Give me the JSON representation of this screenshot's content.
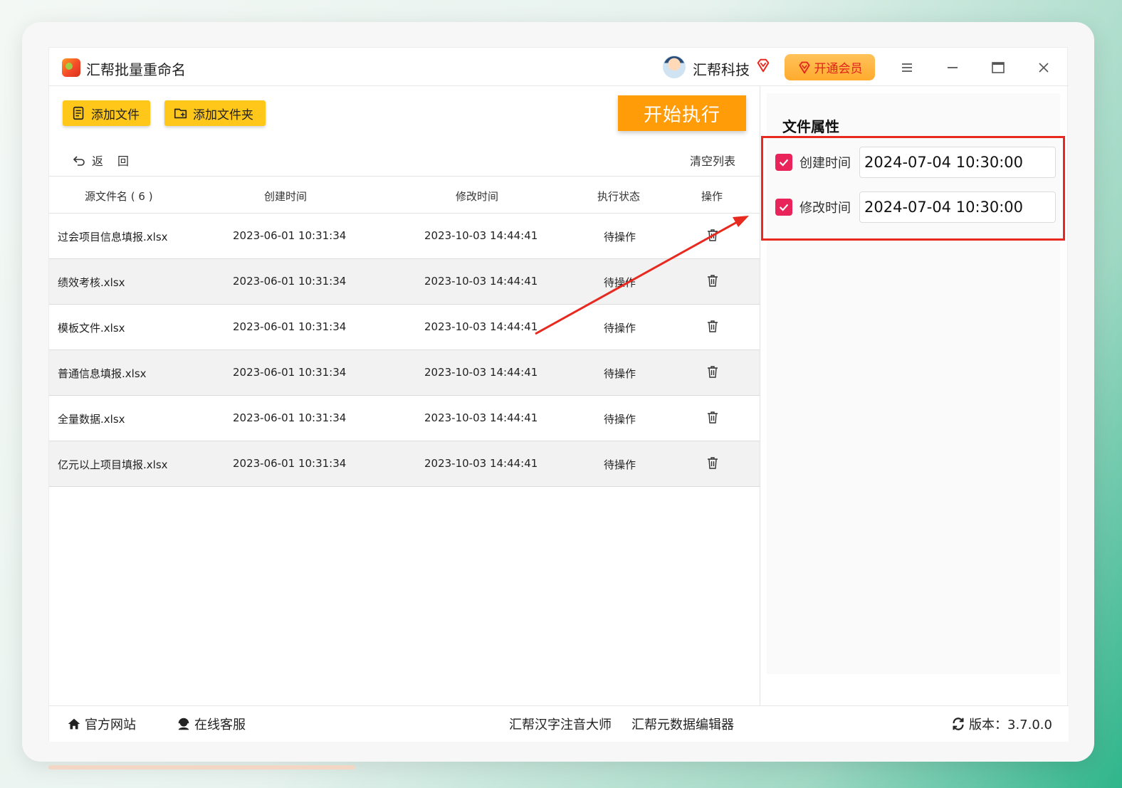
{
  "app": {
    "title": "汇帮批量重命名",
    "user_name": "汇帮科技",
    "vip_label": "开通会员"
  },
  "toolbar": {
    "add_file_label": "添加文件",
    "add_folder_label": "添加文件夹",
    "start_label": "开始执行",
    "back_label": "返回",
    "clear_label": "清空列表"
  },
  "table": {
    "headers": {
      "name": "源文件名 ( 6 )",
      "created": "创建时间",
      "modified": "修改时间",
      "status": "执行状态",
      "op": "操作"
    },
    "rows": [
      {
        "name": "过会项目信息填报.xlsx",
        "created": "2023-06-01 10:31:34",
        "modified": "2023-10-03 14:44:41",
        "status": "待操作"
      },
      {
        "name": "绩效考核.xlsx",
        "created": "2023-06-01 10:31:34",
        "modified": "2023-10-03 14:44:41",
        "status": "待操作"
      },
      {
        "name": "模板文件.xlsx",
        "created": "2023-06-01 10:31:34",
        "modified": "2023-10-03 14:44:41",
        "status": "待操作"
      },
      {
        "name": "普通信息填报.xlsx",
        "created": "2023-06-01 10:31:34",
        "modified": "2023-10-03 14:44:41",
        "status": "待操作"
      },
      {
        "name": "全量数据.xlsx",
        "created": "2023-06-01 10:31:34",
        "modified": "2023-10-03 14:44:41",
        "status": "待操作"
      },
      {
        "name": "亿元以上项目填报.xlsx",
        "created": "2023-06-01 10:31:34",
        "modified": "2023-10-03 14:44:41",
        "status": "待操作"
      }
    ]
  },
  "panel": {
    "title": "文件属性",
    "created_label": "创建时间",
    "created_value": "2024-07-04 10:30:00",
    "created_checked": true,
    "modified_label": "修改时间",
    "modified_value": "2024-07-04 10:30:00",
    "modified_checked": true
  },
  "footer": {
    "website_label": "官方网站",
    "support_label": "在线客服",
    "link1_label": "汇帮汉字注音大师",
    "link2_label": "汇帮元数据编辑器",
    "version_label": "版本：3.7.0.0"
  },
  "colors": {
    "accent_yellow": "#ffc71a",
    "start_orange": "#ff9c08",
    "annotation_red": "#e8291f",
    "checkbox_pink": "#e8245a"
  }
}
